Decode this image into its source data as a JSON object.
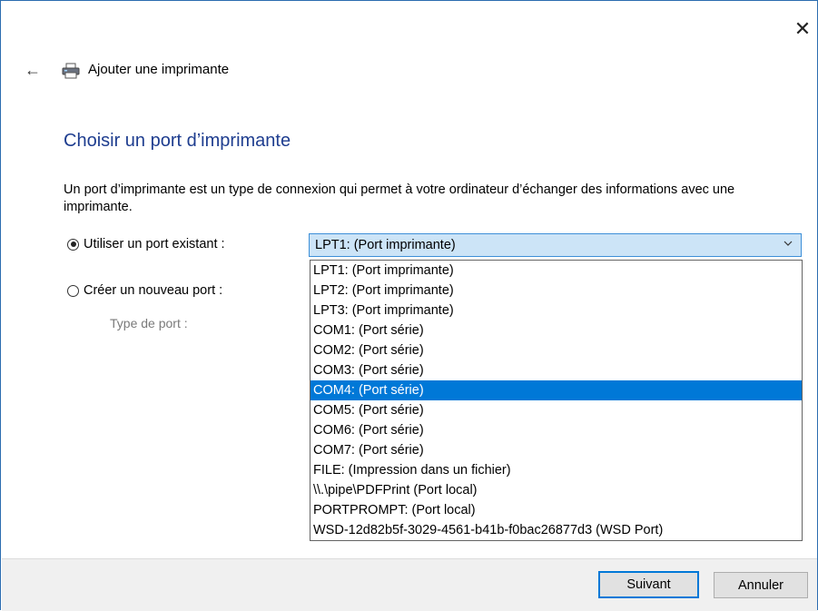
{
  "window": {
    "title": "Ajouter une imprimante"
  },
  "page": {
    "heading": "Choisir un port d’imprimante",
    "description": "Un port d’imprimante est un type de connexion qui permet à votre ordinateur d’échanger des informations avec une imprimante."
  },
  "options": {
    "existing_port_label": "Utiliser un port existant :",
    "new_port_label": "Créer un nouveau port :",
    "port_type_label": "Type de port :"
  },
  "combo": {
    "selected": "LPT1: (Port imprimante)"
  },
  "dropdown": {
    "items": [
      "LPT1: (Port imprimante)",
      "LPT2: (Port imprimante)",
      "LPT3: (Port imprimante)",
      "COM1: (Port série)",
      "COM2: (Port série)",
      "COM3: (Port série)",
      "COM4: (Port série)",
      "COM5: (Port série)",
      "COM6: (Port série)",
      "COM7: (Port série)",
      "FILE: (Impression dans un fichier)",
      "\\\\.\\pipe\\PDFPrint (Port local)",
      "PORTPROMPT: (Port local)",
      "WSD-12d82b5f-3029-4561-b41b-f0bac26877d3 (WSD Port)"
    ],
    "highlighted": "COM4: (Port série)"
  },
  "buttons": {
    "next": "Suivant",
    "cancel": "Annuler"
  },
  "icons": {
    "close": "close-icon",
    "back": "back-arrow-icon",
    "printer": "printer-icon",
    "chevron": "chevron-down-icon"
  },
  "colors": {
    "accent": "#0078d7",
    "heading": "#1e3d8f"
  }
}
